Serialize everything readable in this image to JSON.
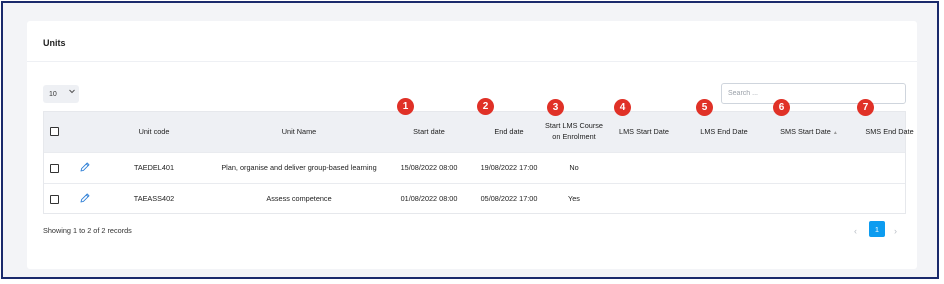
{
  "card": {
    "title": "Units"
  },
  "controls": {
    "page_size": "10",
    "search_placeholder": "Search ..."
  },
  "table": {
    "columns": {
      "unit_code": "Unit code",
      "unit_name": "Unit Name",
      "start_date": "Start date",
      "end_date": "End date",
      "start_lms_line1": "Start LMS Course",
      "start_lms_line2": "on Enrolment",
      "lms_start": "LMS Start Date",
      "lms_end": "LMS End Date",
      "sms_start": "SMS Start Date",
      "sms_end": "SMS End Date",
      "sort_indicator": "▲"
    },
    "rows": [
      {
        "unit_code": "TAEDEL401",
        "unit_name": "Plan, organise and deliver group-based learning",
        "start_date": "15/08/2022 08:00",
        "end_date": "19/08/2022 17:00",
        "start_lms": "No",
        "lms_start": "",
        "lms_end": "",
        "sms_start": "",
        "sms_end": ""
      },
      {
        "unit_code": "TAEASS402",
        "unit_name": "Assess competence",
        "start_date": "01/08/2022 08:00",
        "end_date": "05/08/2022 17:00",
        "start_lms": "Yes",
        "lms_start": "",
        "lms_end": "",
        "sms_start": "",
        "sms_end": ""
      }
    ]
  },
  "annotations": [
    "1",
    "2",
    "3",
    "4",
    "5",
    "6",
    "7"
  ],
  "footer": {
    "records_text": "Showing 1 to 2 of 2 records"
  },
  "pagination": {
    "prev": "‹",
    "current": "1",
    "next": "›"
  },
  "colors": {
    "badge": "#e03127",
    "accent": "#0d9cf0",
    "edit_icon": "#2f7fd6",
    "frame": "#1a2a6c"
  },
  "icons": {
    "edit": "pencil-icon",
    "dropdown": "chevron-down-icon",
    "checkbox": "checkbox"
  }
}
